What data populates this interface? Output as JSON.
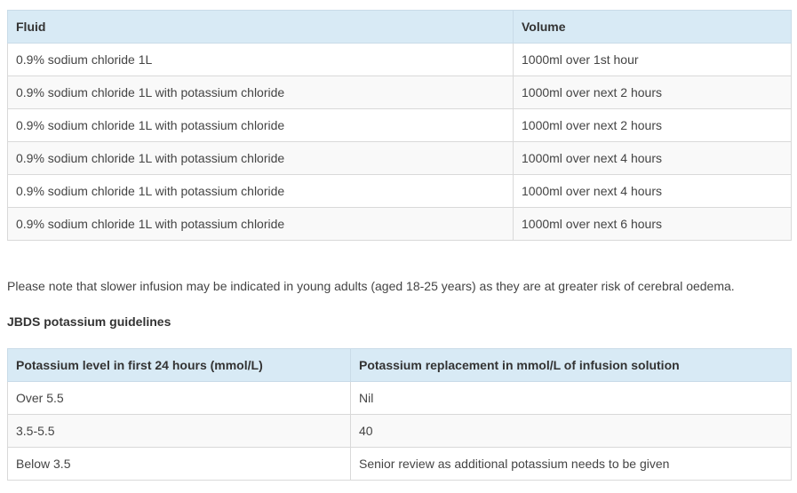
{
  "fluid_table": {
    "headers": [
      "Fluid",
      "Volume"
    ],
    "rows": [
      [
        "0.9% sodium chloride 1L",
        "1000ml over 1st hour"
      ],
      [
        "0.9% sodium chloride 1L with potassium chloride",
        "1000ml over next 2 hours"
      ],
      [
        "0.9% sodium chloride 1L with potassium chloride",
        "1000ml over next 2 hours"
      ],
      [
        "0.9% sodium chloride 1L with potassium chloride",
        "1000ml over next 4 hours"
      ],
      [
        "0.9% sodium chloride 1L with potassium chloride",
        "1000ml over next 4 hours"
      ],
      [
        "0.9% sodium chloride 1L with potassium chloride",
        "1000ml over next 6 hours"
      ]
    ]
  },
  "note": "Please note that slower infusion may be indicated in young adults (aged 18-25 years) as they are at greater risk of cerebral oedema.",
  "potassium_heading": "JBDS potassium guidelines",
  "potassium_table": {
    "headers": [
      "Potassium level in first 24 hours (mmol/L)",
      "Potassium replacement in mmol/L of infusion solution"
    ],
    "rows": [
      [
        "Over 5.5",
        "Nil"
      ],
      [
        "3.5-5.5",
        "40"
      ],
      [
        "Below 3.5",
        "Senior review as additional potassium needs to be given"
      ]
    ]
  },
  "colors": {
    "header_background": "#d8eaf5",
    "border": "#d9d9d9",
    "stripe": "#f9f9f9",
    "text": "#333333"
  }
}
